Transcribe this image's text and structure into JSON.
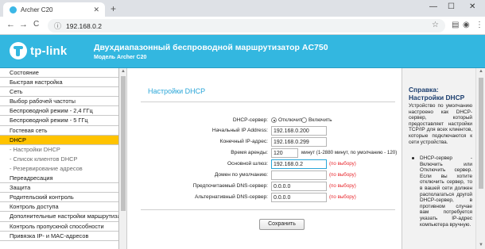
{
  "browser": {
    "tab_title": "Archer C20",
    "tab_close": "✕",
    "new_tab": "+",
    "minimize": "—",
    "maximize": "☐",
    "close": "✕",
    "back": "←",
    "forward": "→",
    "reload": "C",
    "url": "192.168.0.2",
    "star": "☆",
    "icons": [
      "info-icon",
      "star-icon",
      "bookmark-icon",
      "account-icon",
      "menu-icon"
    ]
  },
  "router_header": {
    "logo_text": "tp-link",
    "title": "Двухдиапазонный беспроводной маршрутизатор AC750",
    "model": "Модель Archer C20",
    "accent_color": "#33b7e0"
  },
  "menu": {
    "items": [
      {
        "label": "Состояние",
        "type": "item"
      },
      {
        "label": "Быстрая настройка",
        "type": "item"
      },
      {
        "label": "Сеть",
        "type": "item"
      },
      {
        "label": "Выбор рабочей частоты",
        "type": "item"
      },
      {
        "label": "Беспроводной режим - 2,4 ГГц",
        "type": "item"
      },
      {
        "label": "Беспроводной режим - 5 ГГц",
        "type": "item"
      },
      {
        "label": "Гостевая сеть",
        "type": "item"
      },
      {
        "label": "DHCP",
        "type": "active"
      },
      {
        "label": "- Настройки DHCP",
        "type": "sub"
      },
      {
        "label": "- Список клиентов DHCP",
        "type": "sub"
      },
      {
        "label": "- Резервирование адресов",
        "type": "sub"
      },
      {
        "label": "Переадресация",
        "type": "item"
      },
      {
        "label": "Защита",
        "type": "item"
      },
      {
        "label": "Родительский контроль",
        "type": "item"
      },
      {
        "label": "Контроль доступа",
        "type": "item"
      },
      {
        "label": "Дополнительные настройки маршрутизации",
        "type": "item"
      },
      {
        "label": "Контроль пропускной способности",
        "type": "item"
      },
      {
        "label": "Привязка IP- и MAC-адресов",
        "type": "item"
      }
    ]
  },
  "dhcp": {
    "title": "Настройки DHCP",
    "server_label": "DHCP-сервер:",
    "server_off": "Отключить",
    "server_on": "Включить",
    "start_ip_label": "Начальный IP Address:",
    "start_ip": "192.168.0.200",
    "end_ip_label": "Конечный IP-адрес:",
    "end_ip": "192.168.0.299",
    "lease_label": "Время аренды:",
    "lease_value": "120",
    "lease_hint": "минут (1-2880 минут, по умолчанию - 120)",
    "gateway_label": "Основной шлюз:",
    "gateway_value": "192.168.0.2",
    "optional": "(по выбору)",
    "domain_label": "Домен по умолчанию:",
    "domain_value": "",
    "dns1_label": "Предпочитаемый DNS-сервер:",
    "dns1_value": "0.0.0.0",
    "dns2_label": "Альтернативный DNS-сервер:",
    "dns2_value": "0.0.0.0",
    "save": "Сохранить"
  },
  "help": {
    "title": "Справка: Настройки DHCP",
    "paragraph": "Устройство по умолчанию настроено как DHCP-сервер, который предоставляет настройки TCP/IP для всех клиентов, которые подключаются к сети устройства.",
    "bullet": "DHCP-сервер - Включить или Отключить сервер. Если вы хотите отключить сервер, то в вашей сети должен располагаться другой DHCP-сервер, в противном случае вам потребуется указать IP-адрес компьютера вручную."
  }
}
